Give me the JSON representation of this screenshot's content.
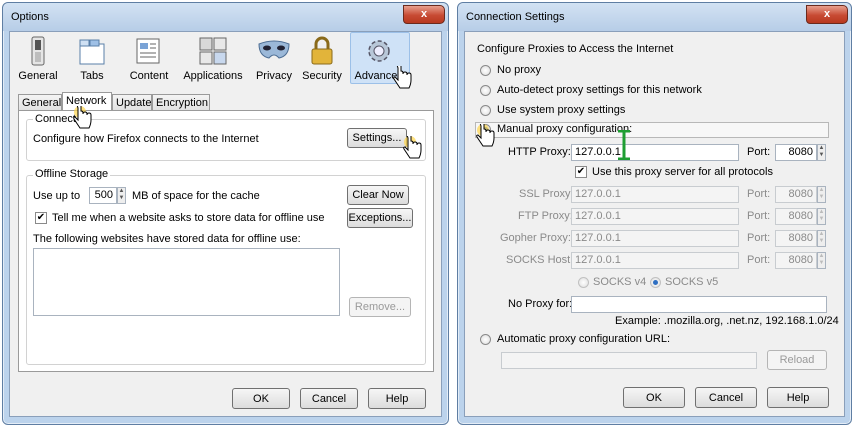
{
  "options": {
    "title": "Options",
    "close": "x",
    "panes": [
      {
        "label": "General",
        "icon": "switch-icon"
      },
      {
        "label": "Tabs",
        "icon": "tabs-icon"
      },
      {
        "label": "Content",
        "icon": "content-icon"
      },
      {
        "label": "Applications",
        "icon": "applications-icon"
      },
      {
        "label": "Privacy",
        "icon": "privacy-mask-icon"
      },
      {
        "label": "Security",
        "icon": "padlock-icon"
      },
      {
        "label": "Advanced",
        "icon": "gear-icon"
      }
    ],
    "tabs": [
      "General",
      "Network",
      "Update",
      "Encryption"
    ],
    "active_tab": "Network",
    "connection": {
      "legend": "Connect",
      "text": "Configure how Firefox connects to the Internet",
      "settings_button": "Settings..."
    },
    "offline": {
      "legend": "Offline Storage",
      "use_up_to": "Use up to",
      "cache_value": "500",
      "cache_suffix": "MB of space for the cache",
      "clear_now": "Clear Now",
      "tell_me": "Tell me when a website asks to store data for offline use",
      "tell_me_checked": true,
      "exceptions": "Exceptions...",
      "websites_label": "The following websites have stored data for offline use:",
      "remove": "Remove..."
    },
    "buttons": {
      "ok": "OK",
      "cancel": "Cancel",
      "help": "Help"
    }
  },
  "connection_settings": {
    "title": "Connection Settings",
    "close": "x",
    "heading": "Configure Proxies to Access the Internet",
    "options": {
      "no_proxy": "No proxy",
      "auto_detect": "Auto-detect proxy settings for this network",
      "system": "Use system proxy settings",
      "manual": "Manual proxy configuration:"
    },
    "selected_option": "manual",
    "http_proxy": {
      "label": "HTTP Proxy:",
      "value": "127.0.0.1",
      "port_label": "Port:",
      "port": "8080"
    },
    "use_same": {
      "label": "Use this proxy server for all protocols",
      "checked": true
    },
    "ssl_proxy": {
      "label": "SSL Proxy:",
      "value": "127.0.0.1",
      "port_label": "Port:",
      "port": "8080"
    },
    "ftp_proxy": {
      "label": "FTP Proxy:",
      "value": "127.0.0.1",
      "port_label": "Port:",
      "port": "8080"
    },
    "gopher_proxy": {
      "label": "Gopher Proxy:",
      "value": "127.0.0.1",
      "port_label": "Port:",
      "port": "8080"
    },
    "socks_host": {
      "label": "SOCKS Host:",
      "value": "127.0.0.1",
      "port_label": "Port:",
      "port": "8080"
    },
    "socks_v4": "SOCKS v4",
    "socks_v5": "SOCKS v5",
    "socks_version_selected": "v5",
    "no_proxy_for": {
      "label": "No Proxy for:",
      "value": ""
    },
    "example": "Example: .mozilla.org, .net.nz, 192.168.1.0/24",
    "auto_url": {
      "label": "Automatic proxy configuration URL:",
      "value": "",
      "reload": "Reload"
    },
    "buttons": {
      "ok": "OK",
      "cancel": "Cancel",
      "help": "Help"
    }
  },
  "colors": {
    "window_frame": "#bcd3ec",
    "client_bg": "#f0f0f0",
    "close_button": "#c74a33",
    "accent_blue": "#2f6fc2",
    "annotation_green": "#1e9e32"
  }
}
